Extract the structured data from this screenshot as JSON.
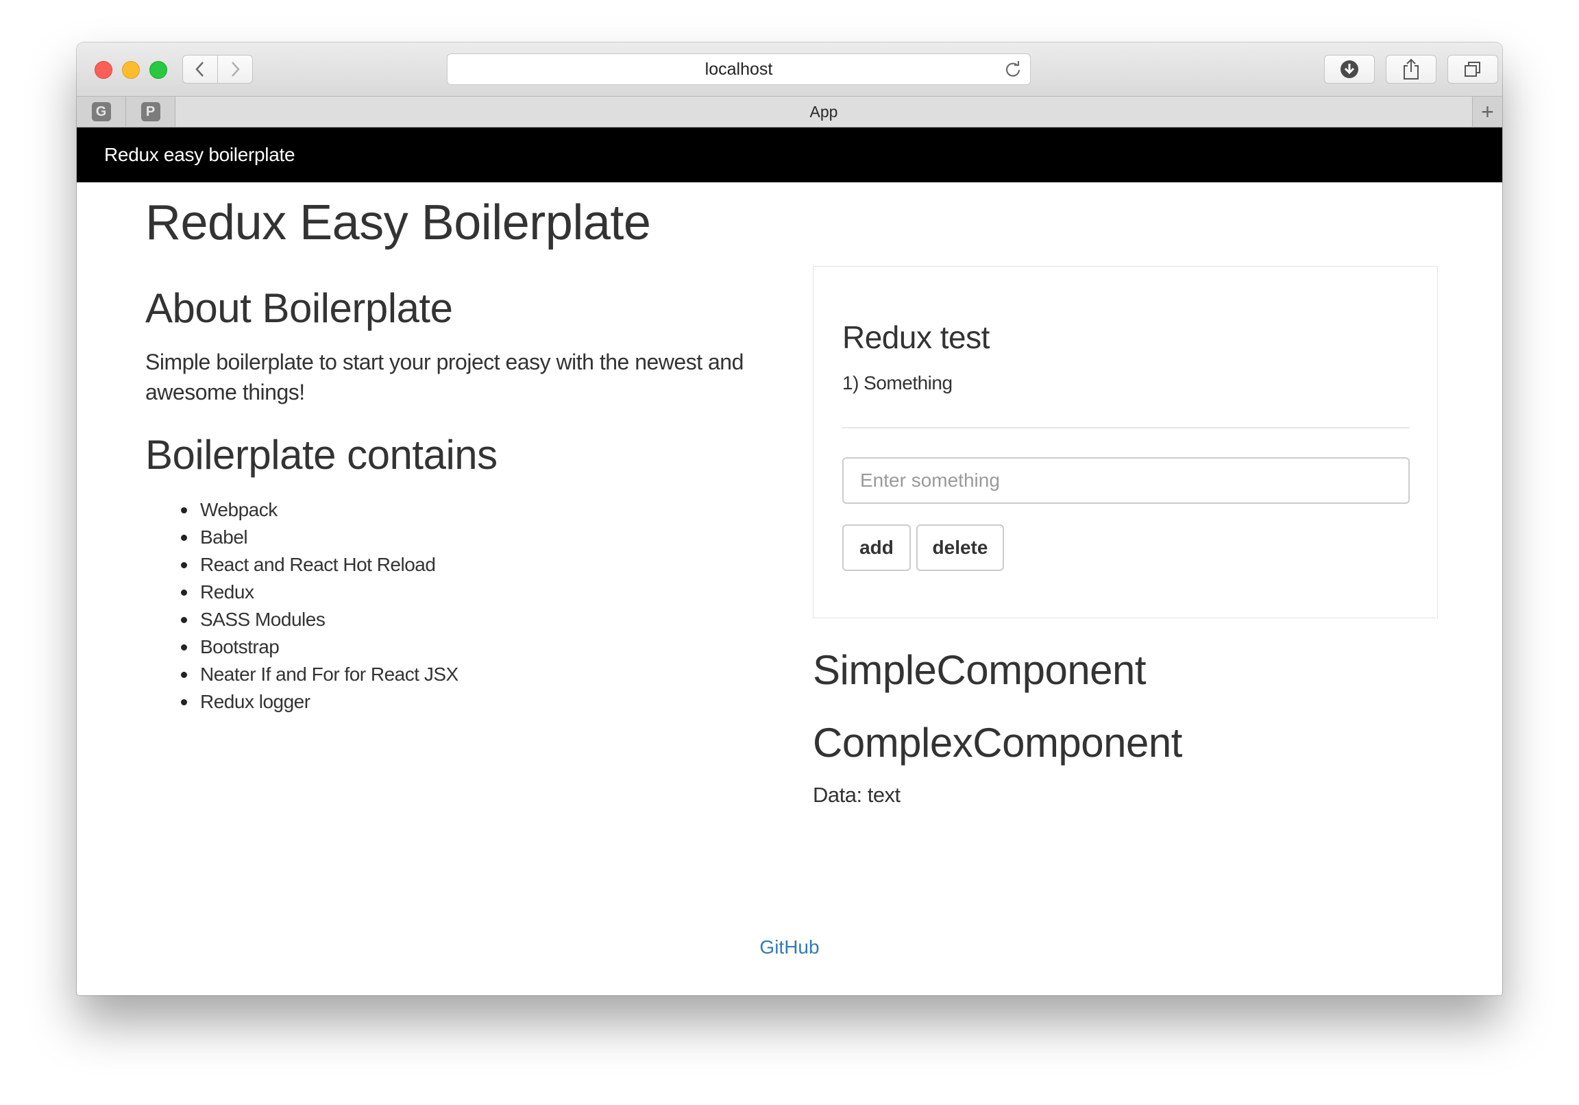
{
  "browser": {
    "url": "localhost",
    "active_tab": "App",
    "pinned_tabs": [
      "G",
      "P"
    ],
    "new_tab_label": "+"
  },
  "navbar": {
    "brand": "Redux easy boilerplate"
  },
  "main": {
    "title": "Redux Easy Boilerplate",
    "about_heading": "About Boilerplate",
    "about_text": "Simple boilerplate to start your project easy with the newest and awesome things!",
    "contains_heading": "Boilerplate contains",
    "contains_items": [
      "Webpack",
      "Babel",
      "React and React Hot Reload",
      "Redux",
      "SASS Modules",
      "Bootstrap",
      "Neater If and For for React JSX",
      "Redux logger"
    ]
  },
  "redux_test": {
    "title": "Redux test",
    "items": [
      "1) Something"
    ],
    "input_placeholder": "Enter something",
    "input_value": "",
    "add_label": "add",
    "delete_label": "delete"
  },
  "simple_component": {
    "heading": "SimpleComponent"
  },
  "complex_component": {
    "heading": "ComplexComponent",
    "data_text": "Data: text"
  },
  "footer": {
    "link_text": "GitHub",
    "link_color": "#337ab7"
  }
}
